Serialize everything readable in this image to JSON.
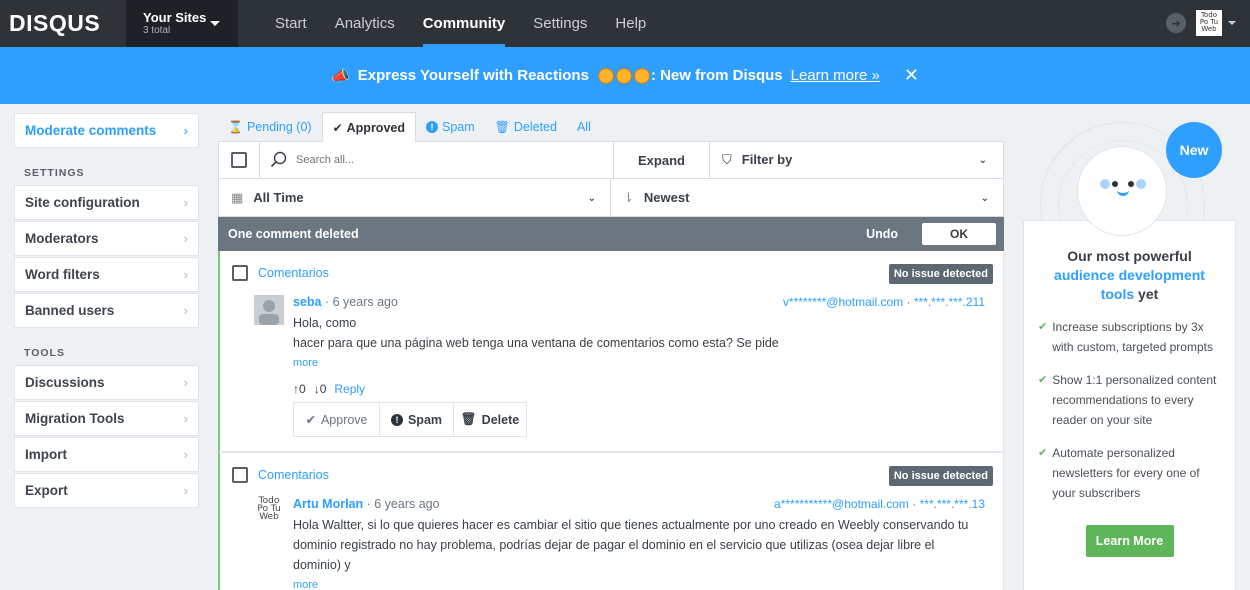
{
  "topbar": {
    "logo": "DISQUS",
    "sites_label": "Your Sites",
    "sites_count": "3 total",
    "nav": [
      "Start",
      "Analytics",
      "Community",
      "Settings",
      "Help"
    ],
    "active_nav": "Community",
    "avatar_text": "Todo Po Tu Web"
  },
  "banner": {
    "text": "Express Yourself with Reactions",
    "suffix": ": New from Disqus",
    "link": "Learn more »",
    "close": "✕"
  },
  "sidebar": {
    "moderate": "Moderate comments",
    "settings_heading": "SETTINGS",
    "settings": [
      "Site configuration",
      "Moderators",
      "Word filters",
      "Banned users"
    ],
    "tools_heading": "TOOLS",
    "tools": [
      "Discussions",
      "Migration Tools",
      "Import",
      "Export"
    ]
  },
  "tabs": {
    "pending": "Pending (0)",
    "approved": "Approved",
    "spam": "Spam",
    "deleted": "Deleted",
    "all": "All"
  },
  "toolbar": {
    "search_placeholder": "Search all...",
    "expand": "Expand",
    "filter": "Filter by",
    "time": "All Time",
    "sort": "Newest"
  },
  "notice": {
    "text": "One comment deleted",
    "undo": "Undo",
    "ok": "OK"
  },
  "comments": [
    {
      "thread": "Comentarios",
      "badge": "No issue detected",
      "author": "seba",
      "time": "6 years ago",
      "email": "v********@hotmail.com",
      "ip": "***.***.***.211",
      "line1": "Hola, como",
      "line2": "hacer para que una página web tenga una ventana de comentarios como esta? Se pide",
      "more": "more",
      "upvotes": "0",
      "downvotes": "0",
      "reply": "Reply",
      "approve": "Approve",
      "spam": "Spam",
      "delete": "Delete"
    },
    {
      "thread": "Comentarios",
      "badge": "No issue detected",
      "author": "Artu Morlan",
      "time": "6 years ago",
      "email": "a***********@hotmail.com",
      "ip": "***.***.***.13",
      "avatar_text": "Todo Po Tu Web",
      "line1": "Hola Waltter, si lo que quieres hacer es cambiar el sitio que tienes actualmente por uno creado en Weebly conservando tu",
      "line2": "dominio registrado no hay problema, podrías dejar de pagar el dominio en el servicio que utilizas (osea dejar libre el dominio) y",
      "more": "more"
    }
  ],
  "promo": {
    "new_badge": "New",
    "title_pre": "Our most powerful",
    "title_hl": "audience development tools",
    "title_post": "yet",
    "features": [
      "Increase subscriptions by 3x with custom, targeted prompts",
      "Show 1:1 personalized content recommendations to every reader on your site",
      "Automate personalized newsletters for every one of your subscribers"
    ],
    "cta": "Learn More"
  },
  "colors": {
    "accent": "#2e9fff",
    "topbar": "#2e3338",
    "success": "#5fb55a"
  }
}
